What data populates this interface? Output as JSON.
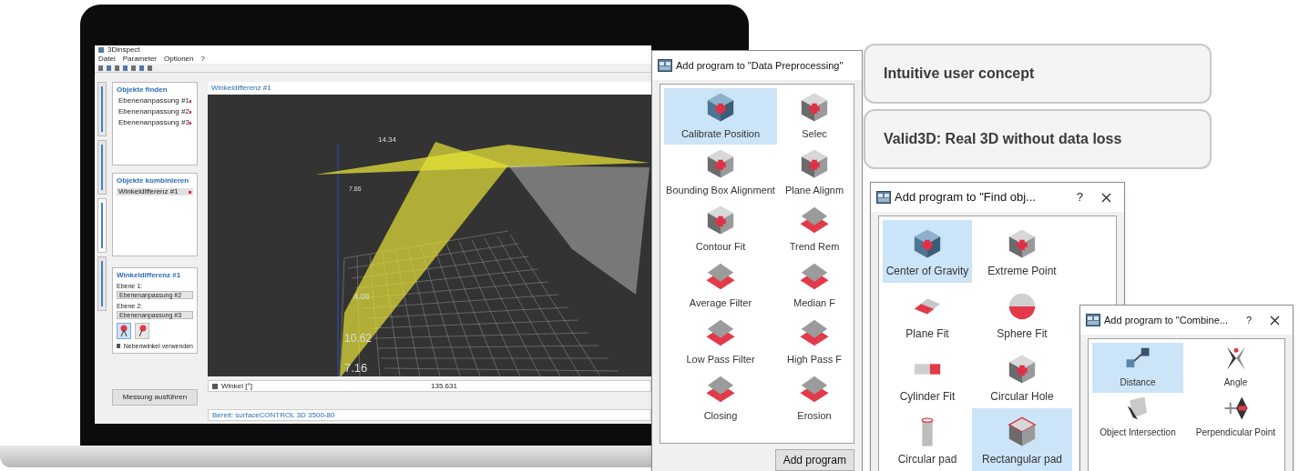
{
  "app": {
    "title": "3Dinspect",
    "menu": [
      "Datei",
      "Parameter",
      "Optionen",
      "?"
    ],
    "side_tabs": [
      {
        "selected": false
      },
      {
        "selected": false
      },
      {
        "selected": true
      },
      {
        "selected": false
      }
    ],
    "panels": [
      {
        "title": "Objekte finden",
        "items": [
          "Ebenenanpassung #1",
          "Ebenenanpassung #2",
          "Ebenenanpassung #3"
        ]
      },
      {
        "title": "Objekte kombinieren",
        "items": [
          "Winkeldifferenz #1"
        ]
      }
    ],
    "detail": {
      "title": "Winkeldifferenz #1",
      "fields": [
        {
          "label": "Ebene 1:",
          "value": "Ebenenanpassung #2"
        },
        {
          "label": "Ebene 2:",
          "value": "Ebenenanpassung #3"
        }
      ],
      "checkbox": {
        "label": "Nebenwinkel verwenden",
        "checked": true
      }
    },
    "run_button": "Messung ausführen",
    "view_title": "Winkeldifferenz #1",
    "axis_labels": [
      "14.34",
      "7.86",
      "4.08",
      "10.62",
      "7.16"
    ],
    "result": {
      "label": "Winkel [°]",
      "value": "135.631",
      "checked": true
    },
    "status": "Bereit: surfaceCONTROL 3D 3500-80"
  },
  "callouts": [
    "Intuitive user concept",
    "Valid3D: Real 3D without data loss"
  ],
  "dialogs": [
    {
      "title": "Add program to \"Data Preprocessing\"",
      "button": "Add program",
      "items": [
        {
          "label": "Calibrate Position",
          "kind": "cube-blue",
          "selected": true
        },
        {
          "label": "Selec",
          "kind": "cube-gray",
          "selected": false
        },
        {
          "label": "Bounding Box Alignment",
          "kind": "cube-gray",
          "selected": false
        },
        {
          "label": "Plane Alignm",
          "kind": "cube-gray",
          "selected": false
        },
        {
          "label": "Contour Fit",
          "kind": "cube-gray",
          "selected": false
        },
        {
          "label": "Trend Rem",
          "kind": "layers",
          "selected": false
        },
        {
          "label": "Average Filter",
          "kind": "layers",
          "selected": false
        },
        {
          "label": "Median F",
          "kind": "layers",
          "selected": false
        },
        {
          "label": "Low Pass Filter",
          "kind": "layers",
          "selected": false
        },
        {
          "label": "High Pass F",
          "kind": "layers",
          "selected": false
        },
        {
          "label": "Closing",
          "kind": "layers",
          "selected": false
        },
        {
          "label": "Erosion",
          "kind": "layers",
          "selected": false
        }
      ]
    },
    {
      "title": "Add program to \"Find obj...",
      "help": "?",
      "items": [
        {
          "label": "Center of Gravity",
          "kind": "cube-blue",
          "selected": true
        },
        {
          "label": "Extreme Point",
          "kind": "cube-gray",
          "selected": false
        },
        {
          "label": "Plane Fit",
          "kind": "plane",
          "selected": false
        },
        {
          "label": "Sphere Fit",
          "kind": "sphere",
          "selected": false
        },
        {
          "label": "Cylinder Fit",
          "kind": "cylinder",
          "selected": false
        },
        {
          "label": "Circular Hole",
          "kind": "cube-gray",
          "selected": false
        },
        {
          "label": "Circular pad",
          "kind": "pillar",
          "selected": false
        },
        {
          "label": "Rectangular pad",
          "kind": "box",
          "selected": true
        }
      ]
    },
    {
      "title": "Add program to \"Combine...",
      "help": "?",
      "items": [
        {
          "label": "Distance",
          "kind": "distance",
          "selected": true
        },
        {
          "label": "Angle",
          "kind": "angle",
          "selected": false
        },
        {
          "label": "Object Intersection",
          "kind": "intersection",
          "selected": false
        },
        {
          "label": "Perpendicular Point",
          "kind": "crosshair",
          "selected": false
        }
      ]
    }
  ]
}
